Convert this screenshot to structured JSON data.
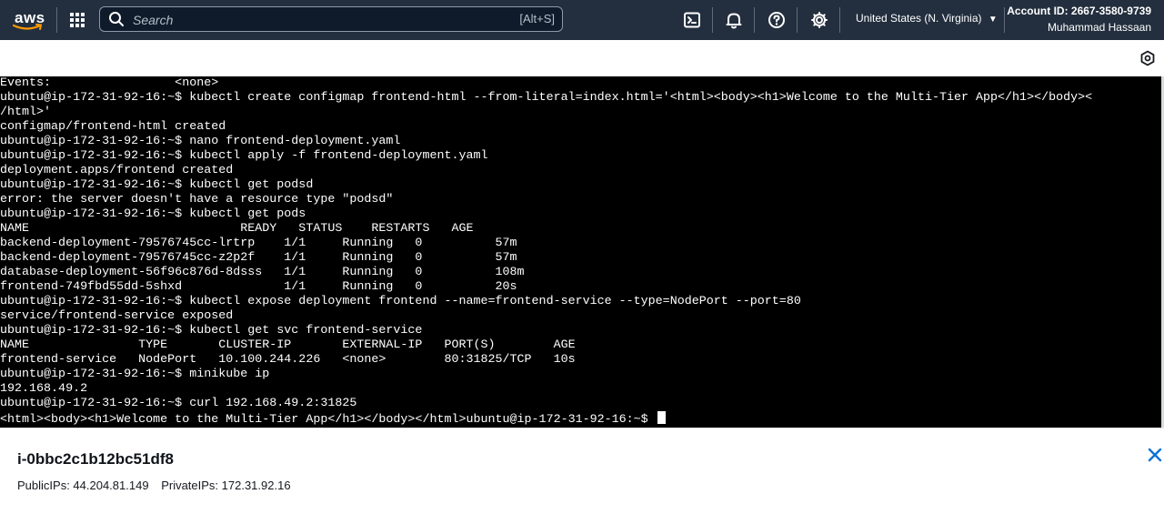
{
  "nav": {
    "logo_text": "aws",
    "search_placeholder": "Search",
    "search_shortcut": "[Alt+S]",
    "region": "United States (N. Virginia)",
    "account_id": "Account ID: 2667-3580-9739",
    "user": "Muhammad Hassaan",
    "icons": [
      "services-grid-icon",
      "search-icon",
      "cloudshell-icon",
      "bell-icon",
      "help-icon",
      "gear-icon"
    ]
  },
  "terminal": {
    "lines": [
      "Events:                 <none>",
      "ubuntu@ip-172-31-92-16:~$ kubectl create configmap frontend-html --from-literal=index.html='<html><body><h1>Welcome to the Multi-Tier App</h1></body><",
      "/html>'",
      "configmap/frontend-html created",
      "ubuntu@ip-172-31-92-16:~$ nano frontend-deployment.yaml",
      "ubuntu@ip-172-31-92-16:~$ kubectl apply -f frontend-deployment.yaml",
      "deployment.apps/frontend created",
      "ubuntu@ip-172-31-92-16:~$ kubectl get podsd",
      "error: the server doesn't have a resource type \"podsd\"",
      "ubuntu@ip-172-31-92-16:~$ kubectl get pods",
      "NAME                             READY   STATUS    RESTARTS   AGE",
      "backend-deployment-79576745cc-lrtrp    1/1     Running   0          57m",
      "backend-deployment-79576745cc-z2p2f    1/1     Running   0          57m",
      "database-deployment-56f96c876d-8dsss   1/1     Running   0          108m",
      "frontend-749fbd55dd-5shxd              1/1     Running   0          20s",
      "ubuntu@ip-172-31-92-16:~$ kubectl expose deployment frontend --name=frontend-service --type=NodePort --port=80",
      "service/frontend-service exposed",
      "ubuntu@ip-172-31-92-16:~$ kubectl get svc frontend-service",
      "NAME               TYPE       CLUSTER-IP       EXTERNAL-IP   PORT(S)        AGE",
      "frontend-service   NodePort   10.100.244.226   <none>        80:31825/TCP   10s",
      "ubuntu@ip-172-31-92-16:~$ minikube ip",
      "192.168.49.2",
      "ubuntu@ip-172-31-92-16:~$ curl 192.168.49.2:31825",
      "<html><body><h1>Welcome to the Multi-Tier App</h1></body></html>ubuntu@ip-172-31-92-16:~$ "
    ]
  },
  "instance": {
    "id": "i-0bbc2c1b12bc51df8",
    "public_ips": "PublicIPs: 44.204.81.149",
    "private_ips": "PrivateIPs: 172.31.92.16"
  },
  "colors": {
    "nav_bg": "#232f3e",
    "terminal_bg": "#000000",
    "terminal_fg": "#ffffff",
    "close_icon": "#0972d3"
  }
}
